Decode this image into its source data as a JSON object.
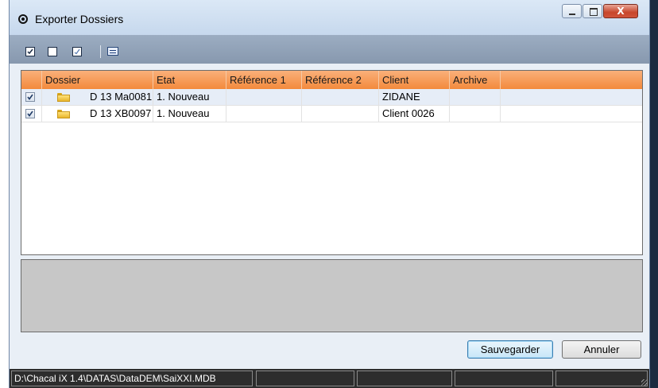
{
  "window": {
    "title": "Exporter Dossiers",
    "app_icon": "chacal-logo-icon",
    "controls": {
      "minimize": "minimize-icon",
      "maximize": "maximize-icon",
      "close_label": "X"
    }
  },
  "toolbar": {
    "items": [
      {
        "name": "select-all",
        "icon": "checked-box-icon"
      },
      {
        "name": "deselect-all",
        "icon": "empty-box-icon"
      },
      {
        "name": "invert-selection",
        "icon": "partial-check-icon"
      },
      {
        "name": "properties",
        "icon": "properties-icon"
      }
    ]
  },
  "grid": {
    "columns": [
      "Dossier",
      "Etat",
      "Référence 1",
      "Référence 2",
      "Client",
      "Archive"
    ],
    "rows": [
      {
        "checked": true,
        "dossier": "D 13 Ma0081",
        "etat": "1. Nouveau",
        "ref1": "",
        "ref2": "",
        "client": "ZIDANE",
        "archive": ""
      },
      {
        "checked": true,
        "dossier": "D 13 XB0097",
        "etat": "1. Nouveau",
        "ref1": "",
        "ref2": "",
        "client": "Client 0026",
        "archive": ""
      }
    ]
  },
  "buttons": {
    "save": "Sauvegarder",
    "cancel": "Annuler"
  },
  "status": {
    "path": "D:\\Chacal iX 1.4\\DATAS\\DataDEM\\SaiXXI.MDB"
  },
  "colors": {
    "header_orange": "#f38a3c",
    "toolbar_blue": "#8798ae",
    "status_dark": "#2d2d2d"
  }
}
